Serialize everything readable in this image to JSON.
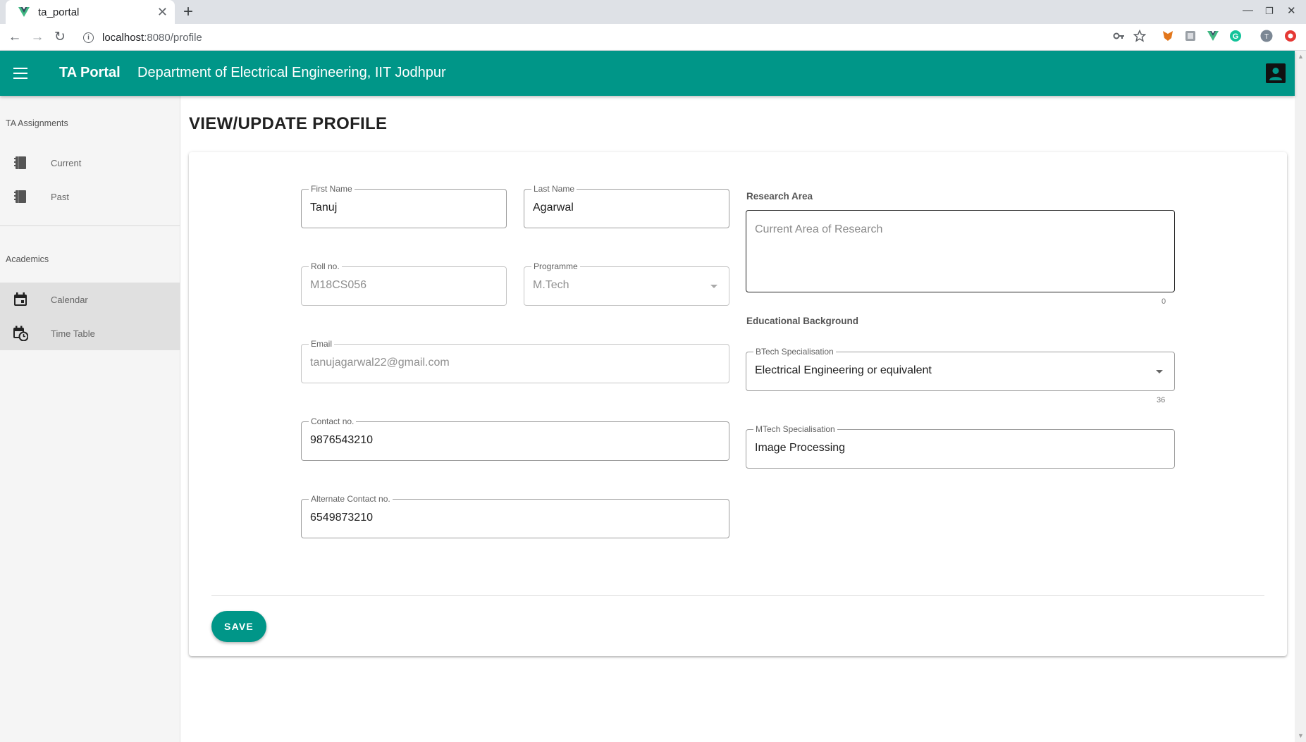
{
  "browser": {
    "tab_title": "ta_portal",
    "url_host": "localhost",
    "url_path": ":8080/profile",
    "profile_initial": "T"
  },
  "appbar": {
    "title": "TA Portal",
    "subtitle": "Department of Electrical Engineering, IIT Jodhpur",
    "color": "#009688"
  },
  "sidebar": {
    "sections": [
      {
        "header": "TA Assignments",
        "items": [
          {
            "label": "Current",
            "icon": "book-icon"
          },
          {
            "label": "Past",
            "icon": "book-icon"
          }
        ]
      },
      {
        "header": "Academics",
        "items": [
          {
            "label": "Calendar",
            "icon": "calendar-icon"
          },
          {
            "label": "Time Table",
            "icon": "calendar-clock-icon"
          }
        ]
      }
    ]
  },
  "page": {
    "title": "VIEW/UPDATE PROFILE"
  },
  "form": {
    "first_name": {
      "label": "First Name",
      "value": "Tanuj"
    },
    "last_name": {
      "label": "Last Name",
      "value": "Agarwal"
    },
    "roll_no": {
      "label": "Roll no.",
      "value": "M18CS056"
    },
    "programme": {
      "label": "Programme",
      "value": "M.Tech"
    },
    "email": {
      "label": "Email",
      "value": "tanujagarwal22@gmail.com"
    },
    "contact": {
      "label": "Contact no.",
      "value": "9876543210"
    },
    "alt_contact": {
      "label": "Alternate Contact no.",
      "value": "6549873210"
    },
    "research_area": {
      "label": "Research Area",
      "placeholder": "Current Area of Research",
      "counter": "0"
    },
    "educational_background": {
      "label": "Educational Background"
    },
    "btech": {
      "label": "BTech Specialisation",
      "value": "Electrical Engineering or equivalent",
      "counter": "36"
    },
    "mtech": {
      "label": "MTech Specialisation",
      "value": "Image Processing"
    },
    "save_label": "SAVE"
  }
}
